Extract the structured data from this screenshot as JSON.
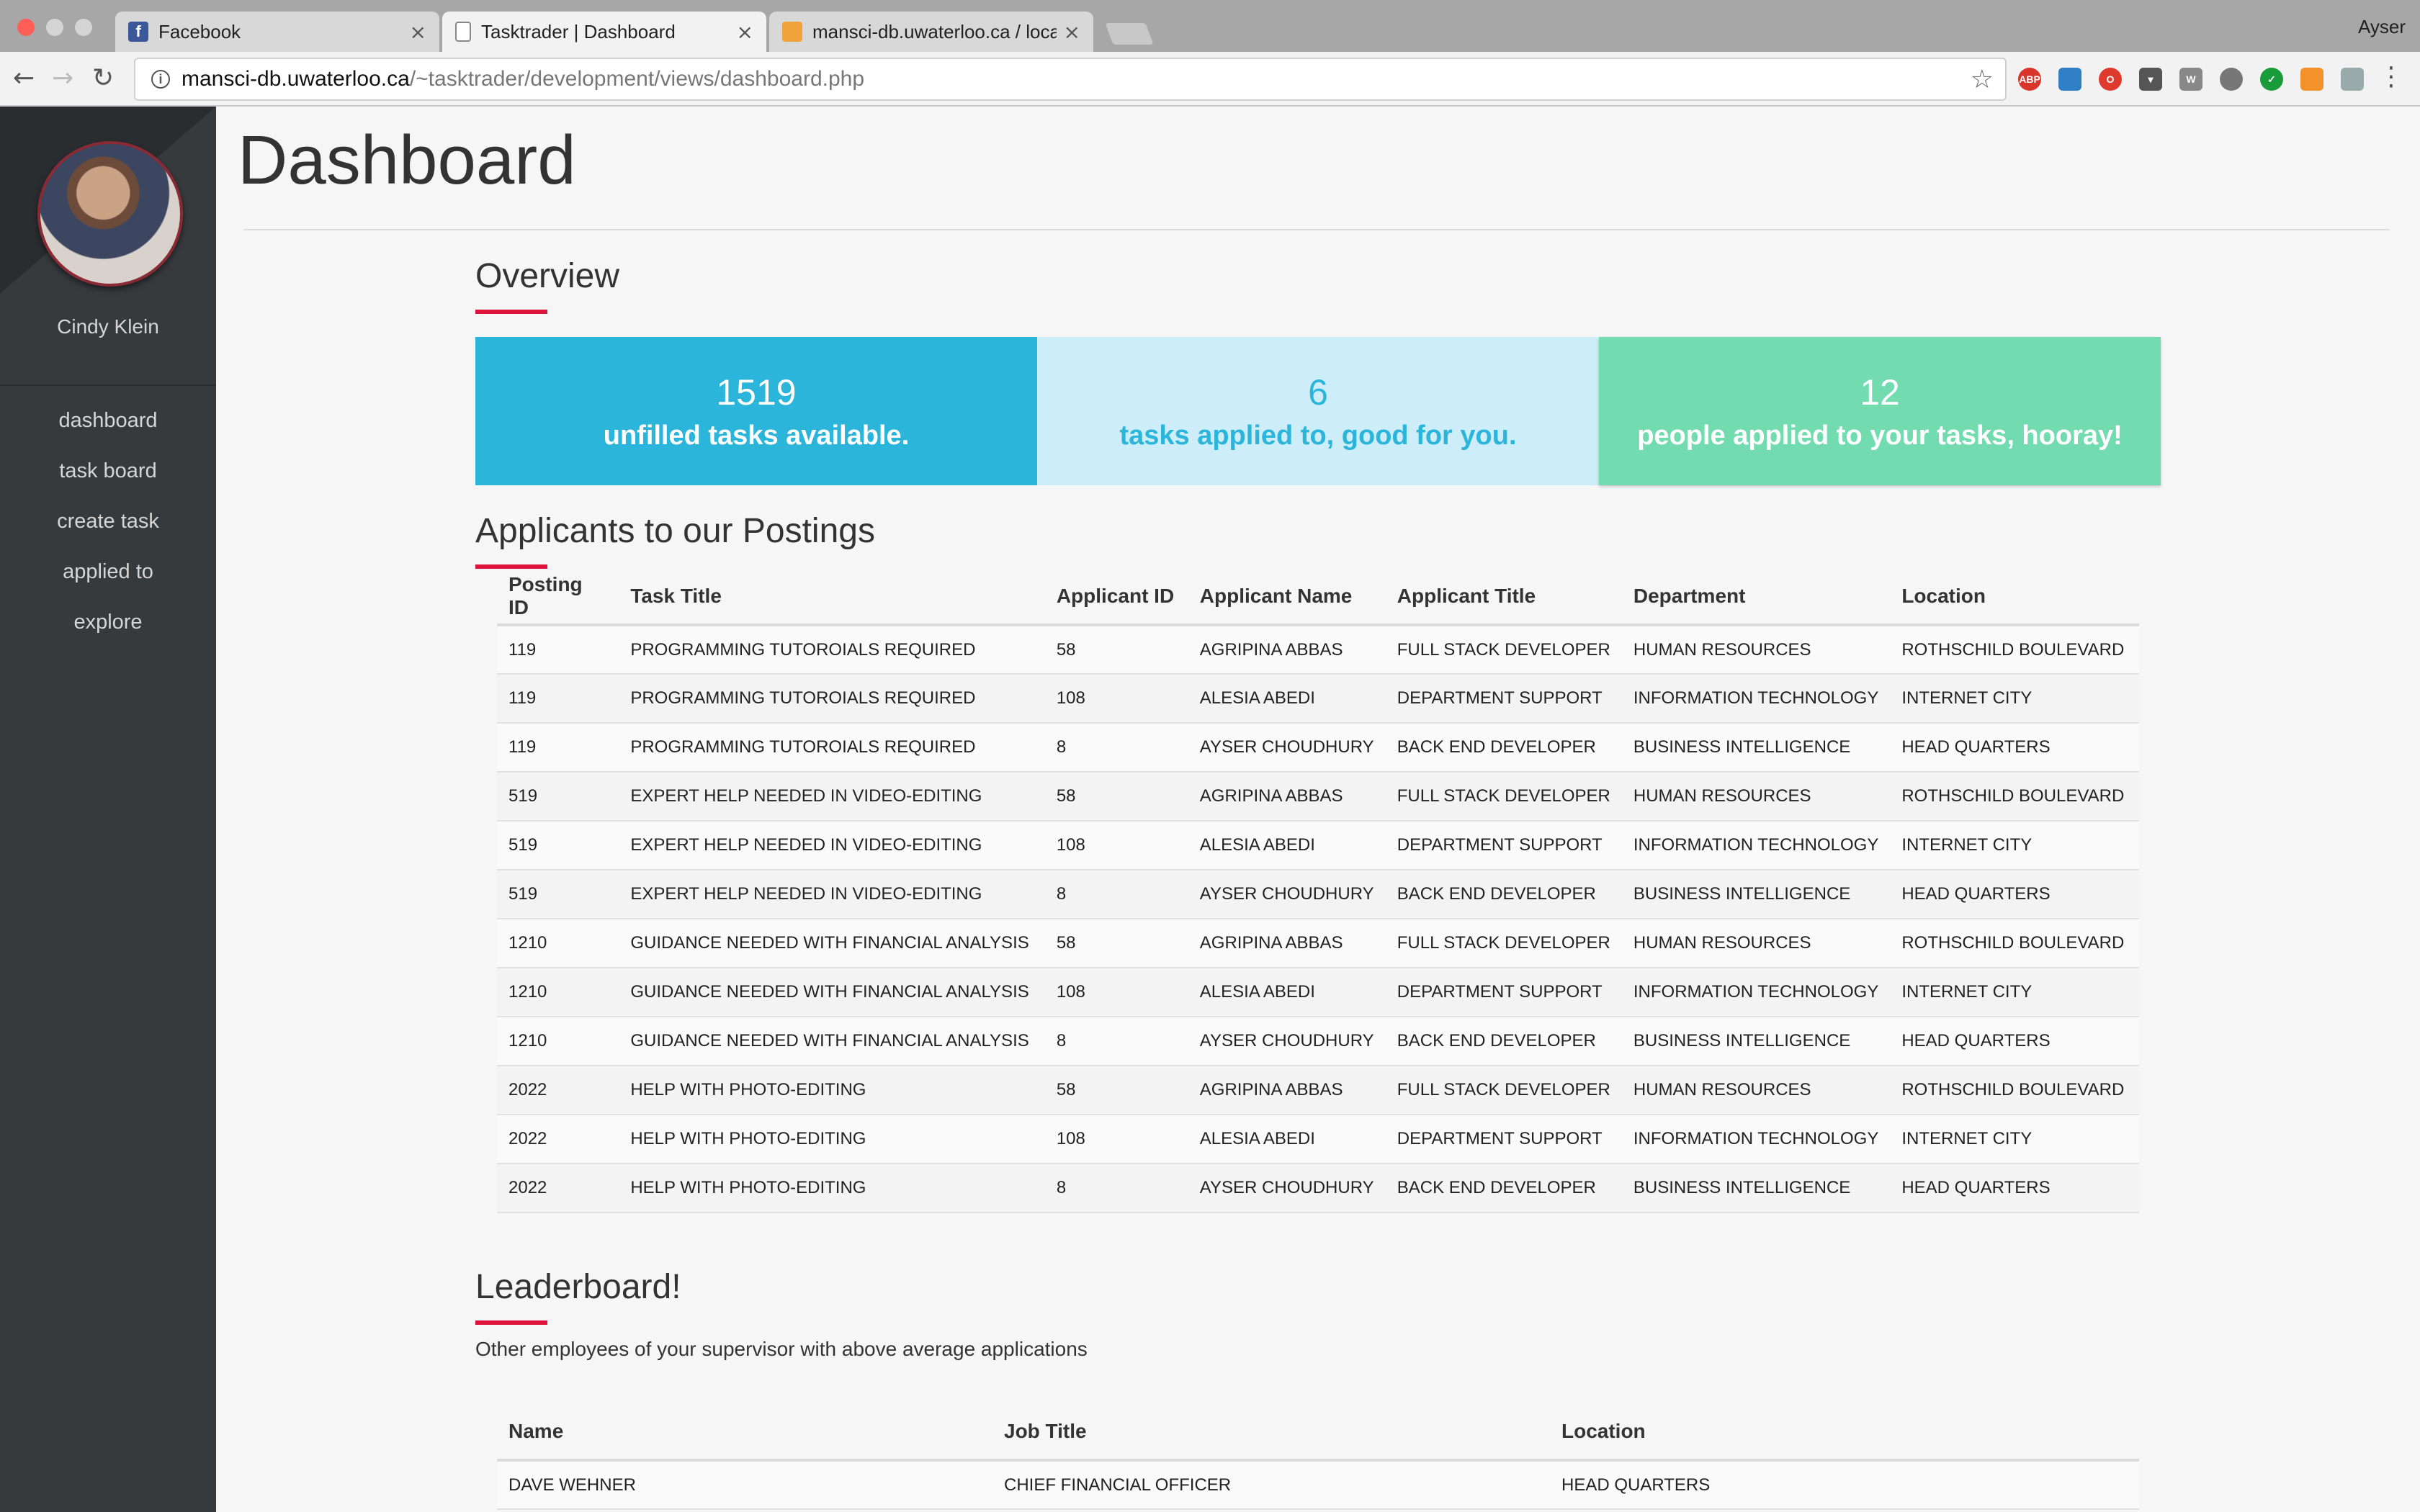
{
  "browser": {
    "tabs": [
      {
        "title": "Facebook",
        "icon": "facebook-icon"
      },
      {
        "title": "Tasktrader | Dashboard",
        "icon": "page-icon"
      },
      {
        "title": "mansci-db.uwaterloo.ca / local",
        "icon": "phpmyadmin-icon"
      }
    ],
    "profile_name": "Ayser",
    "url_host": "mansci-db.uwaterloo.ca",
    "url_path": "/~tasktrader/development/views/dashboard.php"
  },
  "sidebar": {
    "user_name": "Cindy Klein",
    "items": [
      {
        "label": "dashboard"
      },
      {
        "label": "task board"
      },
      {
        "label": "create task"
      },
      {
        "label": "applied to"
      },
      {
        "label": "explore"
      }
    ]
  },
  "page": {
    "title": "Dashboard"
  },
  "overview": {
    "title": "Overview",
    "stats": [
      {
        "value": "1519",
        "label": "unfilled tasks available.",
        "bg": "#2bb5db",
        "fg": "#ffffff"
      },
      {
        "value": "6",
        "label": "tasks applied to, good for you.",
        "bg": "#cdeef8",
        "fg": "#2bb5db"
      },
      {
        "value": "12",
        "label": "people applied to your tasks, hooray!",
        "bg": "#72dcb0",
        "fg": "#ffffff"
      }
    ]
  },
  "applicants": {
    "title": "Applicants to our Postings",
    "columns": [
      "Posting ID",
      "Task Title",
      "Applicant ID",
      "Applicant Name",
      "Applicant Title",
      "Department",
      "Location"
    ],
    "rows": [
      [
        "119",
        "PROGRAMMING TUTOROIALS REQUIRED",
        "58",
        "AGRIPINA ABBAS",
        "FULL STACK DEVELOPER",
        "HUMAN RESOURCES",
        "ROTHSCHILD BOULEVARD"
      ],
      [
        "119",
        "PROGRAMMING TUTOROIALS REQUIRED",
        "108",
        "ALESIA ABEDI",
        "DEPARTMENT SUPPORT",
        "INFORMATION TECHNOLOGY",
        "INTERNET CITY"
      ],
      [
        "119",
        "PROGRAMMING TUTOROIALS REQUIRED",
        "8",
        "AYSER CHOUDHURY",
        "BACK END DEVELOPER",
        "BUSINESS INTELLIGENCE",
        "HEAD QUARTERS"
      ],
      [
        "519",
        "EXPERT HELP NEEDED IN VIDEO-EDITING",
        "58",
        "AGRIPINA ABBAS",
        "FULL STACK DEVELOPER",
        "HUMAN RESOURCES",
        "ROTHSCHILD BOULEVARD"
      ],
      [
        "519",
        "EXPERT HELP NEEDED IN VIDEO-EDITING",
        "108",
        "ALESIA ABEDI",
        "DEPARTMENT SUPPORT",
        "INFORMATION TECHNOLOGY",
        "INTERNET CITY"
      ],
      [
        "519",
        "EXPERT HELP NEEDED IN VIDEO-EDITING",
        "8",
        "AYSER CHOUDHURY",
        "BACK END DEVELOPER",
        "BUSINESS INTELLIGENCE",
        "HEAD QUARTERS"
      ],
      [
        "1210",
        "GUIDANCE NEEDED WITH FINANCIAL ANALYSIS",
        "58",
        "AGRIPINA ABBAS",
        "FULL STACK DEVELOPER",
        "HUMAN RESOURCES",
        "ROTHSCHILD BOULEVARD"
      ],
      [
        "1210",
        "GUIDANCE NEEDED WITH FINANCIAL ANALYSIS",
        "108",
        "ALESIA ABEDI",
        "DEPARTMENT SUPPORT",
        "INFORMATION TECHNOLOGY",
        "INTERNET CITY"
      ],
      [
        "1210",
        "GUIDANCE NEEDED WITH FINANCIAL ANALYSIS",
        "8",
        "AYSER CHOUDHURY",
        "BACK END DEVELOPER",
        "BUSINESS INTELLIGENCE",
        "HEAD QUARTERS"
      ],
      [
        "2022",
        "HELP WITH PHOTO-EDITING",
        "58",
        "AGRIPINA ABBAS",
        "FULL STACK DEVELOPER",
        "HUMAN RESOURCES",
        "ROTHSCHILD BOULEVARD"
      ],
      [
        "2022",
        "HELP WITH PHOTO-EDITING",
        "108",
        "ALESIA ABEDI",
        "DEPARTMENT SUPPORT",
        "INFORMATION TECHNOLOGY",
        "INTERNET CITY"
      ],
      [
        "2022",
        "HELP WITH PHOTO-EDITING",
        "8",
        "AYSER CHOUDHURY",
        "BACK END DEVELOPER",
        "BUSINESS INTELLIGENCE",
        "HEAD QUARTERS"
      ]
    ]
  },
  "leaderboard": {
    "title": "Leaderboard!",
    "subtitle": "Other employees of your supervisor with above average applications",
    "columns": [
      "Name",
      "Job Title",
      "Location"
    ],
    "rows": [
      [
        "DAVE WEHNER",
        "CHIEF FINANCIAL OFFICER",
        "HEAD QUARTERS"
      ]
    ]
  },
  "colors": {
    "accent_red": "#dc143c",
    "sidebar_bg": "#363a3d"
  }
}
